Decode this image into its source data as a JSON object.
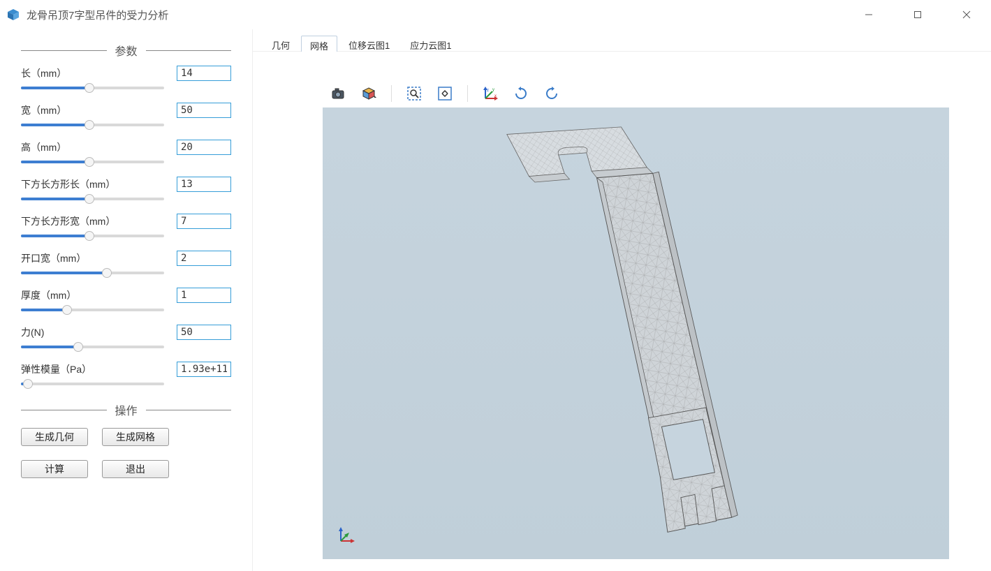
{
  "window": {
    "title": "龙骨吊顶7字型吊件的受力分析"
  },
  "sections": {
    "params": "参数",
    "ops": "操作"
  },
  "params": [
    {
      "label": "长（mm）",
      "value": "14",
      "pct": 48
    },
    {
      "label": "宽（mm）",
      "value": "50",
      "pct": 48
    },
    {
      "label": "高（mm）",
      "value": "20",
      "pct": 48
    },
    {
      "label": "下方长方形长（mm）",
      "value": "13",
      "pct": 48
    },
    {
      "label": "下方长方形宽（mm）",
      "value": "7",
      "pct": 48
    },
    {
      "label": "开口宽（mm）",
      "value": "2",
      "pct": 60
    },
    {
      "label": "厚度（mm）",
      "value": "1",
      "pct": 32
    },
    {
      "label": "力(N)",
      "value": "50",
      "pct": 40
    },
    {
      "label": "弹性模量（Pa）",
      "value": "1.93e+11",
      "pct": 5
    }
  ],
  "buttons": {
    "gen_geom": "生成几何",
    "gen_mesh": "生成网格",
    "compute": "计算",
    "exit": "退出"
  },
  "tabs": [
    {
      "label": "几何"
    },
    {
      "label": "网格"
    },
    {
      "label": "位移云图1"
    },
    {
      "label": "应力云图1"
    }
  ],
  "active_tab": 1,
  "toolbar_icons": [
    "camera-icon",
    "view-cube-icon",
    "zoom-box-icon",
    "zoom-extent-icon",
    "axes-icon",
    "rotate-cw-icon",
    "rotate-ccw-icon"
  ]
}
